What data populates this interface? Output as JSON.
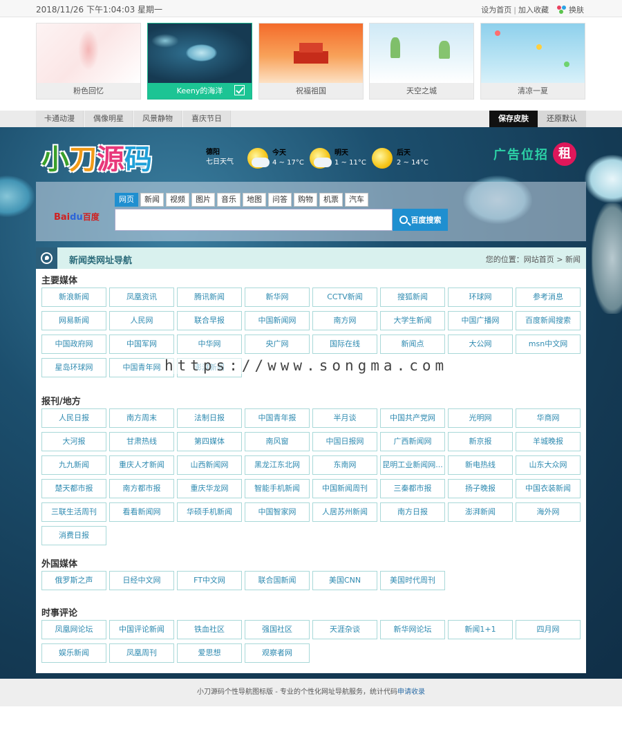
{
  "topbar": {
    "datetime": "2018/11/26 下午1:04:03 星期一",
    "set_home": "设为首页",
    "sep": "|",
    "add_fav": "加入收藏",
    "change_skin": "换肤"
  },
  "skins": [
    {
      "name": "粉色回忆",
      "active": false
    },
    {
      "name": "Keeny的海洋",
      "active": true
    },
    {
      "name": "祝福祖国",
      "active": false
    },
    {
      "name": "天空之城",
      "active": false
    },
    {
      "name": "清凉一夏",
      "active": false
    }
  ],
  "categories": [
    "卡通动漫",
    "偶像明星",
    "风景静物",
    "喜庆节日"
  ],
  "skin_actions": {
    "save": "保存皮肤",
    "restore": "还原默认"
  },
  "header": {
    "logo": [
      "小",
      "刀",
      "源",
      "码"
    ],
    "weather": {
      "city_label": "德阳",
      "city_sub": "七日天气",
      "days": [
        {
          "label": "今天",
          "temp": "4 ~ 17°C"
        },
        {
          "label": "明天",
          "temp": "1 ~ 11°C"
        },
        {
          "label": "后天",
          "temp": "2 ~ 14°C"
        }
      ]
    },
    "ad_text": "广告位招",
    "ad_badge": "租"
  },
  "search": {
    "brand_bai": "Bai",
    "brand_du": "du",
    "brand_cn": "百度",
    "tabs": [
      "网页",
      "新闻",
      "视频",
      "图片",
      "音乐",
      "地图",
      "问答",
      "购物",
      "机票",
      "汽车"
    ],
    "active_tab": 0,
    "button": "百度搜索"
  },
  "panel": {
    "title": "新闻类网址导航",
    "crumb": "您的位置：网站首页 > 新闻"
  },
  "sections": [
    {
      "title": "主要媒体",
      "links": [
        "新浪新闻",
        "凤凰资讯",
        "腾讯新闻",
        "新华网",
        "CCTV新闻",
        "搜狐新闻",
        "环球网",
        "参考消息",
        "网易新闻",
        "人民网",
        "联合早报",
        "中国新闻网",
        "南方网",
        "大学生新闻",
        "中国广播网",
        "百度新闻搜索",
        "中国政府网",
        "中国军网",
        "中华网",
        "央广网",
        "国际在线",
        "新闻点",
        "大公网",
        "msn中文网",
        "星岛环球网",
        "中国青年网",
        "澎湃新闻"
      ]
    },
    {
      "title": "报刊/地方",
      "links": [
        "人民日报",
        "南方周末",
        "法制日报",
        "中国青年报",
        "半月谈",
        "中国共产党网",
        "光明网",
        "华商网",
        "大河报",
        "甘肃热线",
        "第四媒体",
        "南风窗",
        "中国日报网",
        "广西新闻网",
        "新京报",
        "羊城晚报",
        "九九新闻",
        "重庆人才新闻",
        "山西新闻网",
        "黑龙江东北网",
        "东南网",
        "昆明工业新闻网...",
        "新电热线",
        "山东大众网",
        "楚天都市报",
        "南方都市报",
        "重庆华龙网",
        "智能手机新闻",
        "中国新闻周刊",
        "三秦都市报",
        "扬子晚报",
        "中国衣装新闻",
        "三联生活周刊",
        "看看新闻网",
        "华硕手机新闻",
        "中国智家网",
        "人居苏州新闻",
        "南方日报",
        "澎湃新闻",
        "海外网",
        "消费日报"
      ]
    },
    {
      "title": "外国媒体",
      "links": [
        "俄罗斯之声",
        "日经中文网",
        "FT中文网",
        "联合国新闻",
        "美国CNN",
        "美国时代周刊"
      ]
    },
    {
      "title": "时事评论",
      "links": [
        "凤凰网论坛",
        "中国评论新闻",
        "铁血社区",
        "强国社区",
        "天涯杂谈",
        "新华网论坛",
        "新闻1+1",
        "四月网",
        "娱乐新闻",
        "凤凰周刊",
        "爱思想",
        "观察者网"
      ]
    }
  ],
  "watermark": "https://www.songma.com",
  "footer": {
    "text": "小刀源码个性导航图标版 - 专业的个性化网址导航服务，统计代码",
    "link": "申请收录"
  }
}
